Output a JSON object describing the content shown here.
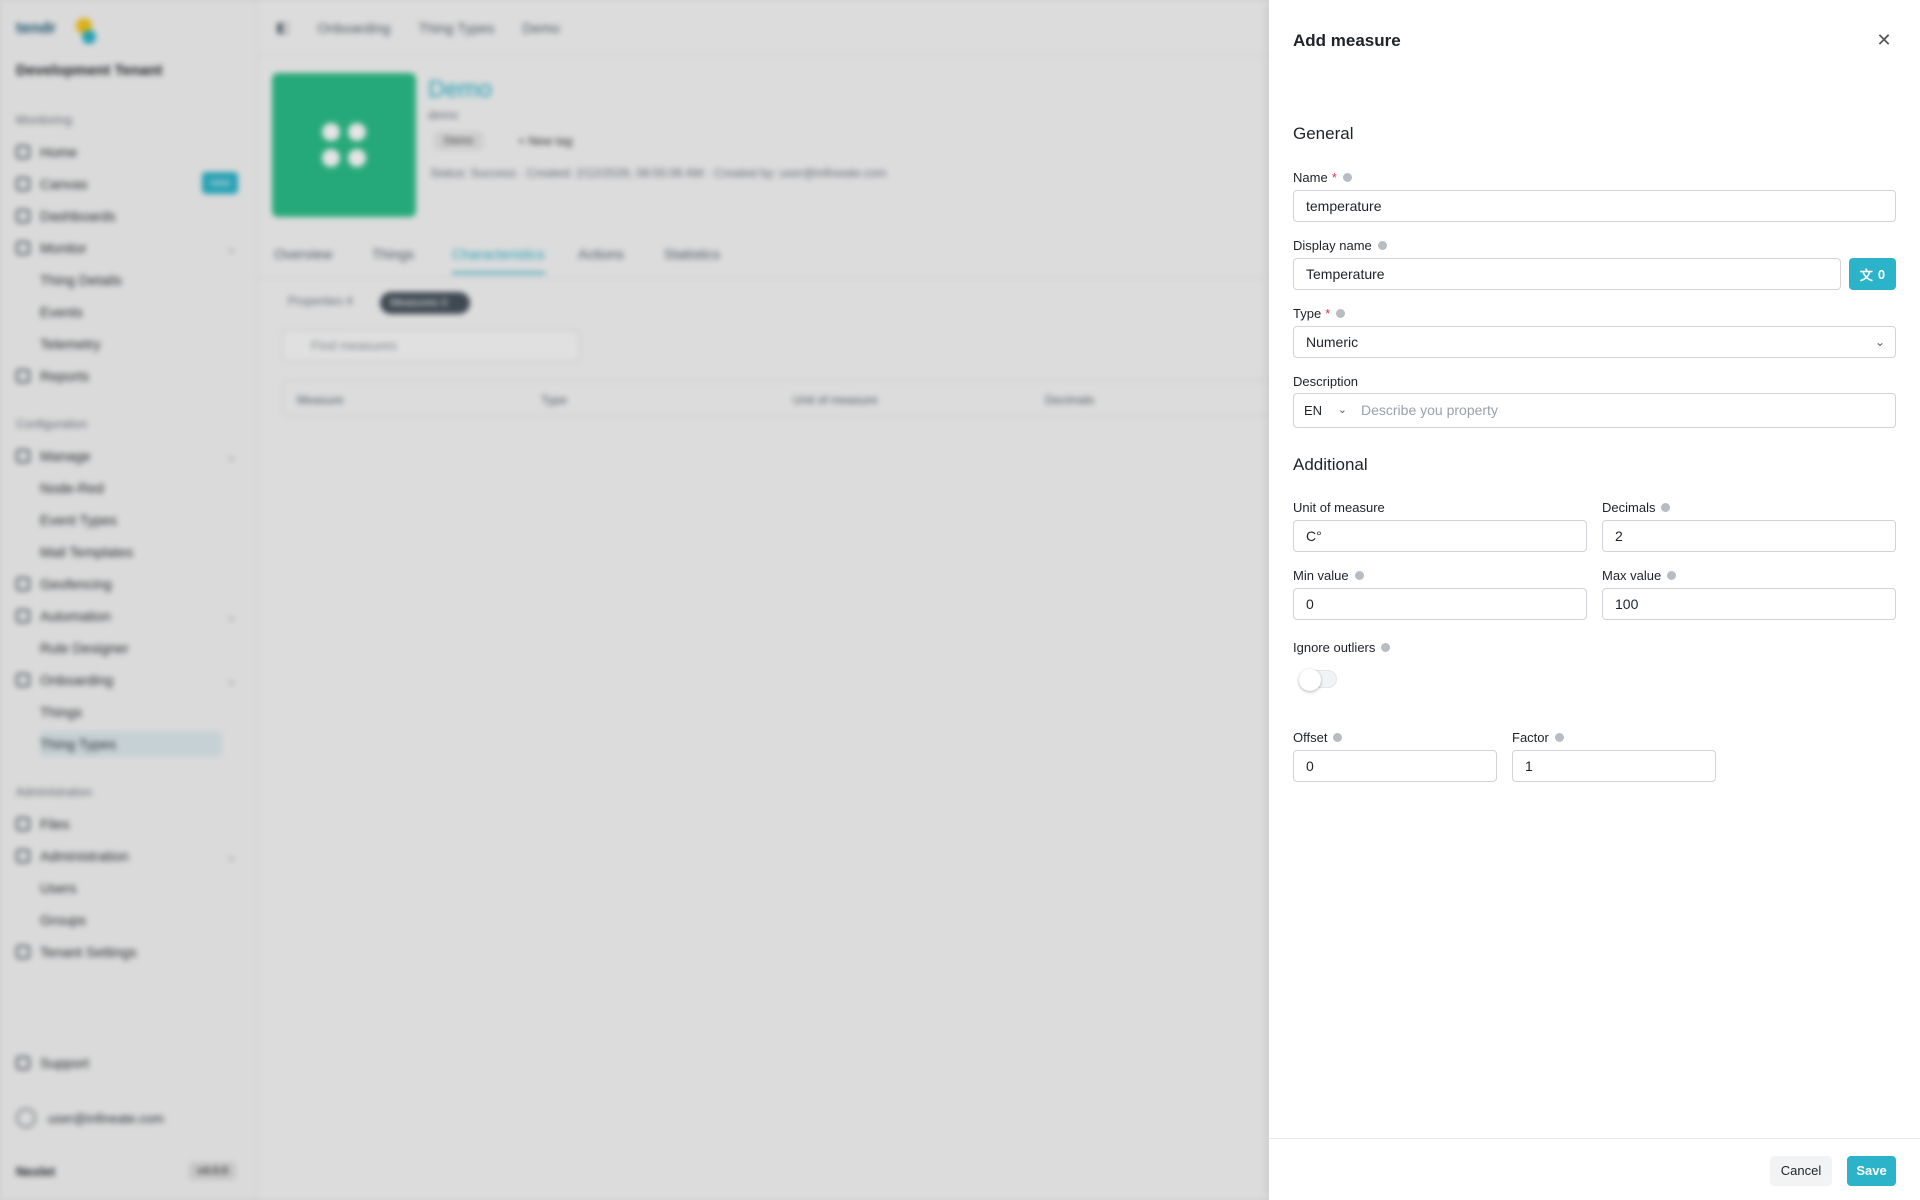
{
  "background": {
    "logo_text": "tendr",
    "tenant": "Development Tenant",
    "sections": {
      "monitoring": "Monitoring",
      "configuration": "Configuration",
      "administration": "Administration"
    },
    "items": {
      "home": "Home",
      "canvas": "Canvas",
      "dashboards": "Dashboards",
      "monitor": "Monitor",
      "thing_details": "Thing Details",
      "events": "Events",
      "telemetry": "Telemetry",
      "reports": "Reports",
      "manage": "Manage",
      "node_red": "Node-Red",
      "event_types": "Event Types",
      "mail_templates": "Mail Templates",
      "geofencing": "Geofencing",
      "automation": "Automation",
      "rule_designer": "Rule Designer",
      "onboarding": "Onboarding",
      "things": "Things",
      "thing_types": "Thing Types",
      "files": "Files",
      "administration": "Administration",
      "users": "Users",
      "groups": "Groups",
      "tenant_settings": "Tenant Settings",
      "support": "Support"
    },
    "canvas_badge": "new",
    "user_email": "user@infineate.com",
    "footer_brand": "Nexlet",
    "footer_version": "v4.0.0",
    "breadcrumb": [
      "Onboarding",
      "Thing Types",
      "Demo"
    ],
    "entity": {
      "title": "Demo",
      "subtitle": "demo",
      "tag": "Demo",
      "new_tag": "+ New tag",
      "meta": "Status: Success  ·  Created: 2/12/2026, 08:55:06 AM  ·  Created by: user@infineate.com"
    },
    "tabs": [
      "Overview",
      "Things",
      "Characteristics",
      "Actions",
      "Statistics"
    ],
    "pills": {
      "properties": "Properties 4",
      "measures": "Measures 0"
    },
    "find_placeholder": "Find measures",
    "table_columns": [
      "Measure",
      "Type",
      "Unit of measure",
      "Decimals"
    ]
  },
  "drawer": {
    "title": "Add measure",
    "general_title": "General",
    "name_label": "Name",
    "name_value": "temperature",
    "display_name_label": "Display name",
    "display_name_value": "Temperature",
    "translate_count": "0",
    "type_label": "Type",
    "type_value": "Numeric",
    "description_label": "Description",
    "description_lang": "EN",
    "description_placeholder": "Describe you property",
    "additional_title": "Additional",
    "unit_label": "Unit of measure",
    "unit_value": "C°",
    "decimals_label": "Decimals",
    "decimals_value": "2",
    "min_label": "Min value",
    "min_value": "0",
    "max_label": "Max value",
    "max_value": "100",
    "ignore_outliers_label": "Ignore outliers",
    "offset_label": "Offset",
    "offset_value": "0",
    "factor_label": "Factor",
    "factor_value": "1",
    "cancel_label": "Cancel",
    "save_label": "Save"
  },
  "colors": {
    "accent": "#2bb3c9",
    "required": "#e0334d",
    "tile": "#2bbd88"
  }
}
